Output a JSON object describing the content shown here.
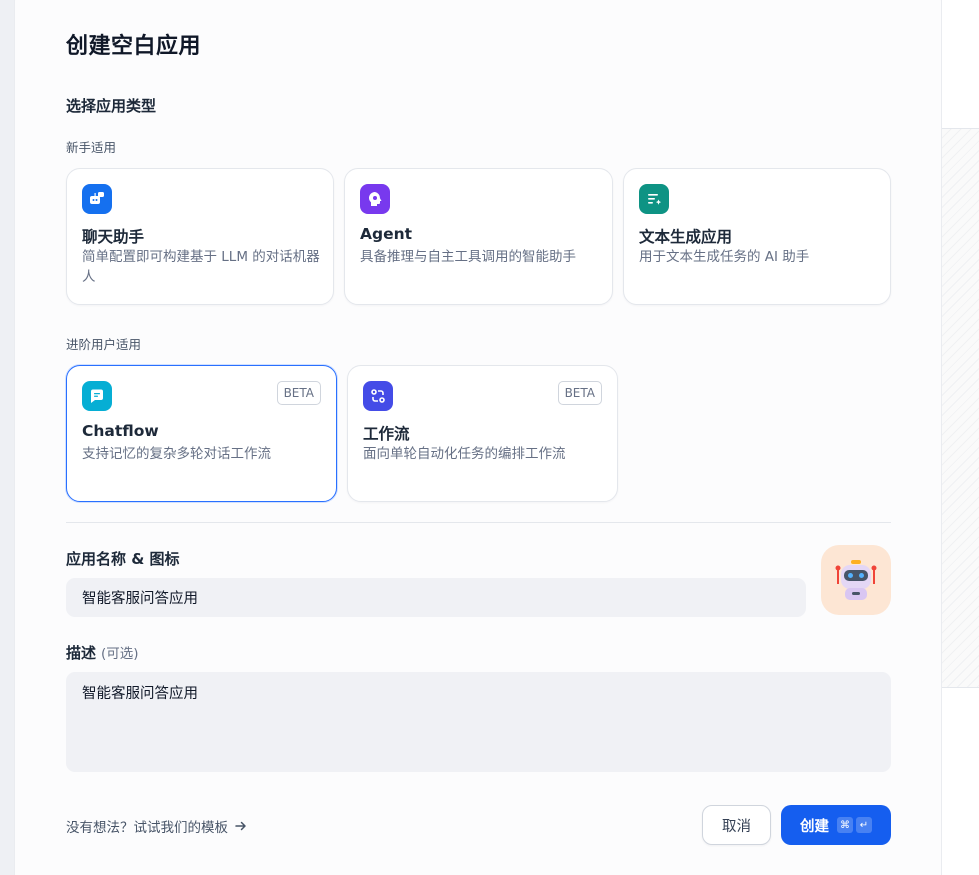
{
  "dialog": {
    "title": "创建空白应用",
    "section_label": "选择应用类型"
  },
  "groups": {
    "beginner": "新手适用",
    "advanced": "进阶用户适用"
  },
  "cards": {
    "chat": {
      "title": "聊天助手",
      "desc": "简单配置即可构建基于 LLM 的对话机器人",
      "icon": "chat-bot-icon",
      "color": "#1570ef"
    },
    "agent": {
      "title": "Agent",
      "desc": "具备推理与自主工具调用的智能助手",
      "icon": "brain-icon",
      "color": "#7839ee"
    },
    "textgen": {
      "title": "文本生成应用",
      "desc": "用于文本生成任务的 AI 助手",
      "icon": "text-sparkle-icon",
      "color": "#0e9384"
    },
    "chatflow": {
      "title": "Chatflow",
      "desc": "支持记忆的复杂多轮对话工作流",
      "badge": "BETA",
      "icon": "chat-bubble-icon",
      "color": "#06aed4"
    },
    "workflow": {
      "title": "工作流",
      "desc": "面向单轮自动化任务的编排工作流",
      "badge": "BETA",
      "icon": "workflow-icon",
      "color": "#444ce7"
    }
  },
  "form": {
    "name_label": "应用名称 & 图标",
    "name_value": "智能客服问答应用",
    "desc_label": "描述",
    "desc_optional": "(可选)",
    "desc_value": "智能客服问答应用",
    "avatar_icon": "robot-avatar-icon"
  },
  "footer": {
    "template_link": "没有想法？试试我们的模板",
    "cancel": "取消",
    "create": "创建",
    "kbd_cmd": "⌘",
    "kbd_enter": "↵"
  }
}
